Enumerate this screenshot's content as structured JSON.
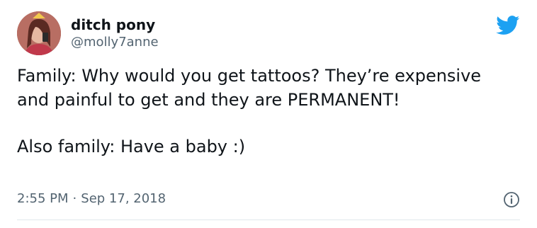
{
  "author": {
    "display_name": "ditch pony",
    "handle": "@molly7anne"
  },
  "tweet": {
    "line1": "Family: Why would you get tattoos? They’re expensive and painful to get and they are PERMANENT!",
    "line2": "Also family: Have a baby :)"
  },
  "meta": {
    "time": "2:55 PM",
    "separator": "·",
    "date": "Sep 17, 2018"
  },
  "icons": {
    "brand": "twitter-bird-icon",
    "info": "info-icon"
  },
  "colors": {
    "brand_blue": "#1DA1F2",
    "text": "#0f1419",
    "secondary": "#536471"
  }
}
